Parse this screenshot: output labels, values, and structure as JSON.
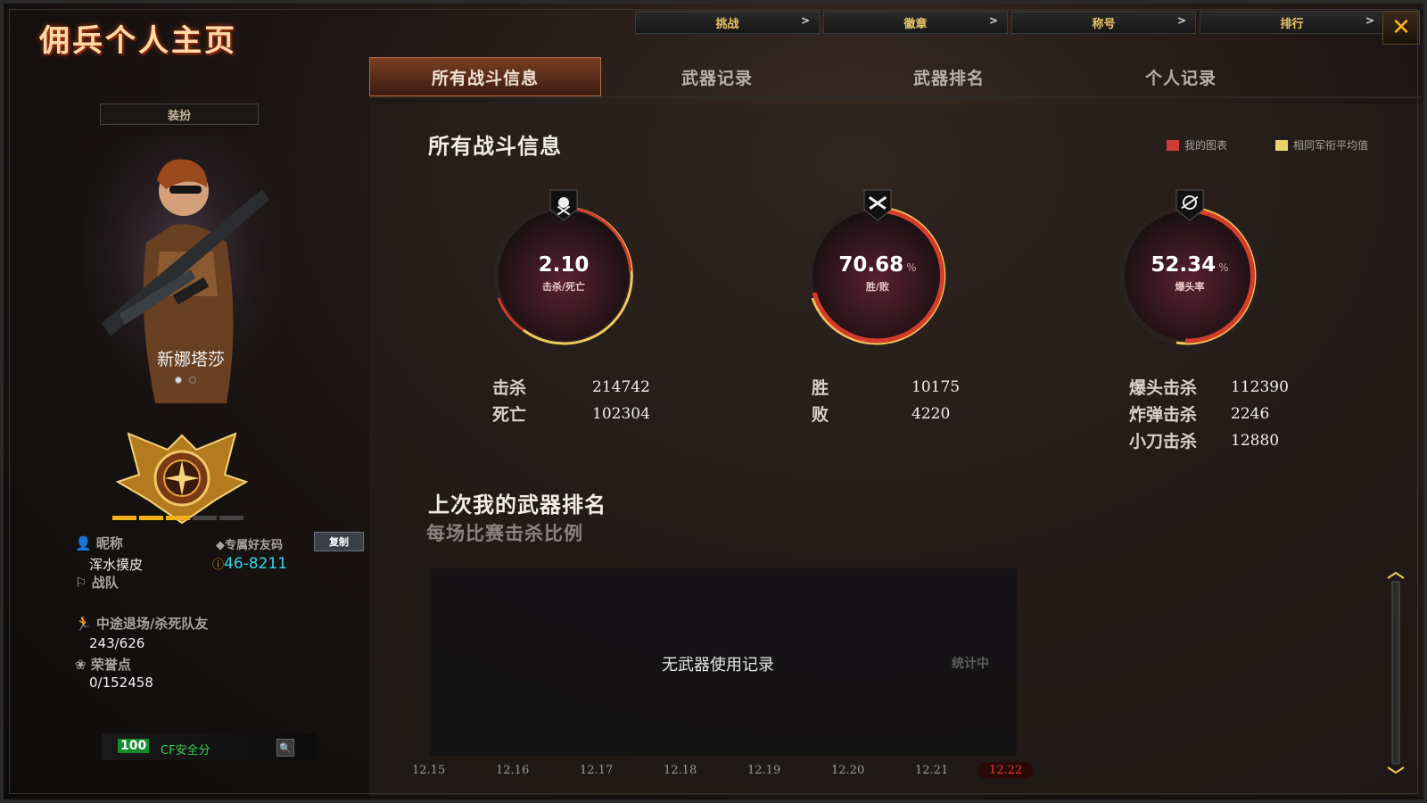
{
  "app": {
    "title": "佣兵个人主页"
  },
  "top_nav": [
    {
      "label": "挑战"
    },
    {
      "label": "徽章"
    },
    {
      "label": "称号"
    },
    {
      "label": "排行"
    }
  ],
  "tabs": [
    {
      "label": "所有战斗信息",
      "active": true
    },
    {
      "label": "武器记录",
      "active": false
    },
    {
      "label": "武器排名",
      "active": false
    },
    {
      "label": "个人记录",
      "active": false
    }
  ],
  "profile": {
    "equip_label": "装扮",
    "character_name": "新娜塔莎",
    "nickname_label": "昵称",
    "nickname": "浑水摸皮",
    "friend_code_label": "专属好友码",
    "friend_code": "46-8211",
    "copy_button": "复制",
    "clan_label": "战队",
    "quit_label": "中途退场/杀死队友",
    "quit_value": "243/626",
    "honor_label": "荣誉点",
    "honor_value": "0/152458",
    "safety_score": "100",
    "safety_label": "CF安全分",
    "rank_progress": 3,
    "rank_total": 5
  },
  "battle": {
    "section_title": "所有战斗信息",
    "legend_mine": "我的图表",
    "legend_avg": "相同军衔平均值",
    "kd": {
      "value": "2.10",
      "label": "击杀/死亡"
    },
    "win": {
      "value": "70.68",
      "unit": "%",
      "label": "胜/败"
    },
    "hs": {
      "value": "52.34",
      "unit": "%",
      "label": "爆头率"
    },
    "stats": {
      "kills_label": "击杀",
      "kills": "214742",
      "deaths_label": "死亡",
      "deaths": "102304",
      "wins_label": "胜",
      "wins": "10175",
      "losses_label": "败",
      "losses": "4220",
      "hs_kills_label": "爆头击杀",
      "hs_kills": "112390",
      "bomb_kills_label": "炸弹击杀",
      "bomb_kills": "2246",
      "knife_kills_label": "小刀击杀",
      "knife_kills": "12880"
    }
  },
  "weapon_rank": {
    "title": "上次我的武器排名",
    "subtitle": "每场比赛击杀比例",
    "empty_msg": "无武器使用记录",
    "side_label": "统计中",
    "dates": [
      "12.15",
      "12.16",
      "12.17",
      "12.18",
      "12.19",
      "12.20",
      "12.21",
      "12.22"
    ],
    "selected_date": "12.22"
  },
  "colors": {
    "accent": "#e9c46a",
    "ring_red": "#d43c2a",
    "ring_yellow": "#f0c75a",
    "mine_swatch": "#d33a3a",
    "avg_swatch": "#e8d36a",
    "safety_green": "#3bd14b"
  }
}
